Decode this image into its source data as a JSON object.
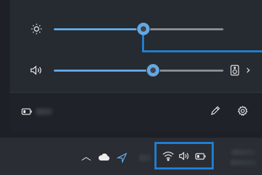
{
  "brightness": {
    "icon": "sun-icon",
    "level": 0.53
  },
  "volume": {
    "icon": "speaker-icon",
    "level": 0.53,
    "output_icon": "audio-output-icon",
    "expand_icon": "chevron-right-icon",
    "expand_glyph": "›"
  },
  "footer": {
    "battery_icon": "battery-icon",
    "edit_icon": "pencil-icon",
    "settings_icon": "gear-icon"
  },
  "taskbar": {
    "tray_icons": [
      "chevron-up-icon",
      "cloud-icon",
      "location-arrow-icon"
    ],
    "tray_glyph": "︿",
    "status_icons": [
      "wifi-icon",
      "volume-icon",
      "battery-icon"
    ]
  },
  "colors": {
    "accent": "#62a8e4",
    "highlight": "#1f7fd4",
    "track": "#8a8d92"
  }
}
